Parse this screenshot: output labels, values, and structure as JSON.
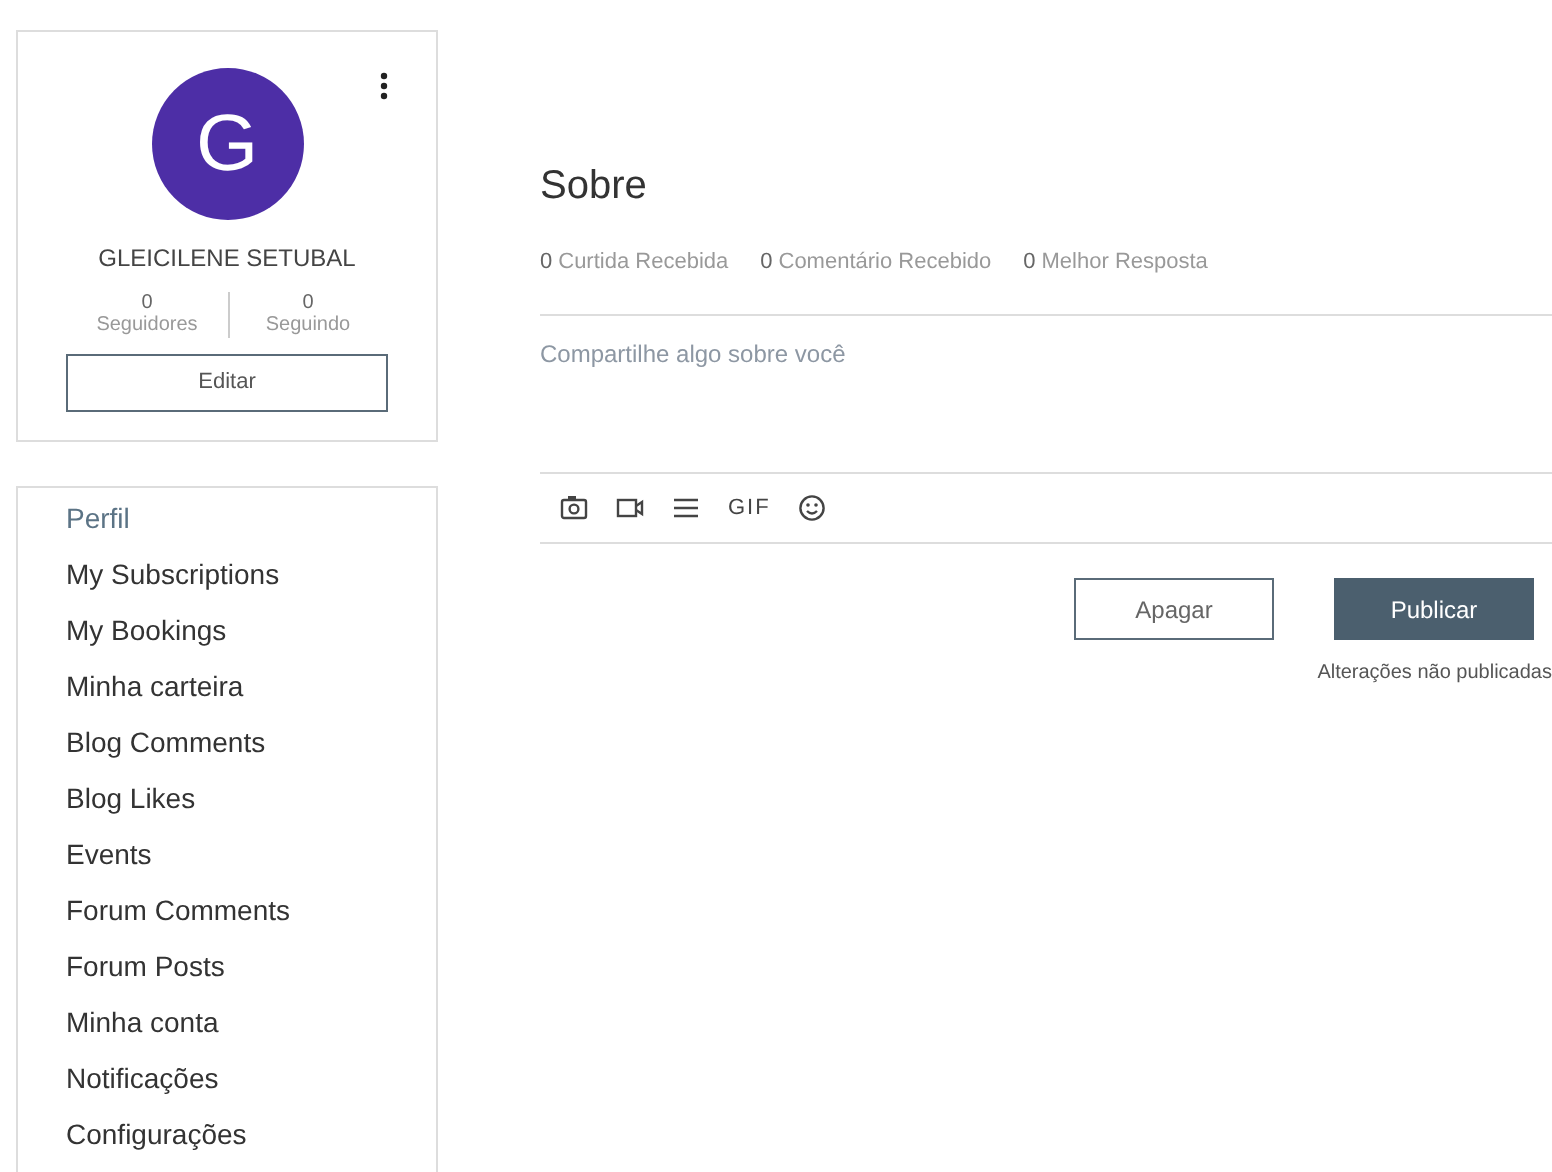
{
  "profile": {
    "avatar_letter": "G",
    "name": "GLEICILENE SETUBAL",
    "stats": [
      {
        "count": "0",
        "label": "Seguidores"
      },
      {
        "count": "0",
        "label": "Seguindo"
      }
    ],
    "edit_button": "Editar"
  },
  "menu": [
    {
      "label": "Perfil",
      "selected": true
    },
    {
      "label": "My Subscriptions",
      "selected": false
    },
    {
      "label": "My Bookings",
      "selected": false
    },
    {
      "label": "Minha carteira",
      "selected": false
    },
    {
      "label": "Blog Comments",
      "selected": false
    },
    {
      "label": "Blog Likes",
      "selected": false
    },
    {
      "label": "Events",
      "selected": false
    },
    {
      "label": "Forum Comments",
      "selected": false
    },
    {
      "label": "Forum Posts",
      "selected": false
    },
    {
      "label": "Minha conta",
      "selected": false
    },
    {
      "label": "Notificações",
      "selected": false
    },
    {
      "label": "Configurações",
      "selected": false
    }
  ],
  "about": {
    "title": "Sobre",
    "stats": [
      {
        "count": "0",
        "label": "Curtida Recebida"
      },
      {
        "count": "0",
        "label": "Comentário Recebido"
      },
      {
        "count": "0",
        "label": "Melhor Resposta"
      }
    ],
    "placeholder": "Compartilhe algo sobre você",
    "toolbar": [
      {
        "kind": "camera"
      },
      {
        "kind": "video"
      },
      {
        "kind": "divider"
      },
      {
        "kind": "text",
        "label": "GIF"
      },
      {
        "kind": "emoji"
      }
    ],
    "buttons": [
      {
        "label": "Apagar",
        "kind": "secondary"
      },
      {
        "label": "Publicar",
        "kind": "primary"
      }
    ],
    "status": "Alterações não publicadas"
  }
}
